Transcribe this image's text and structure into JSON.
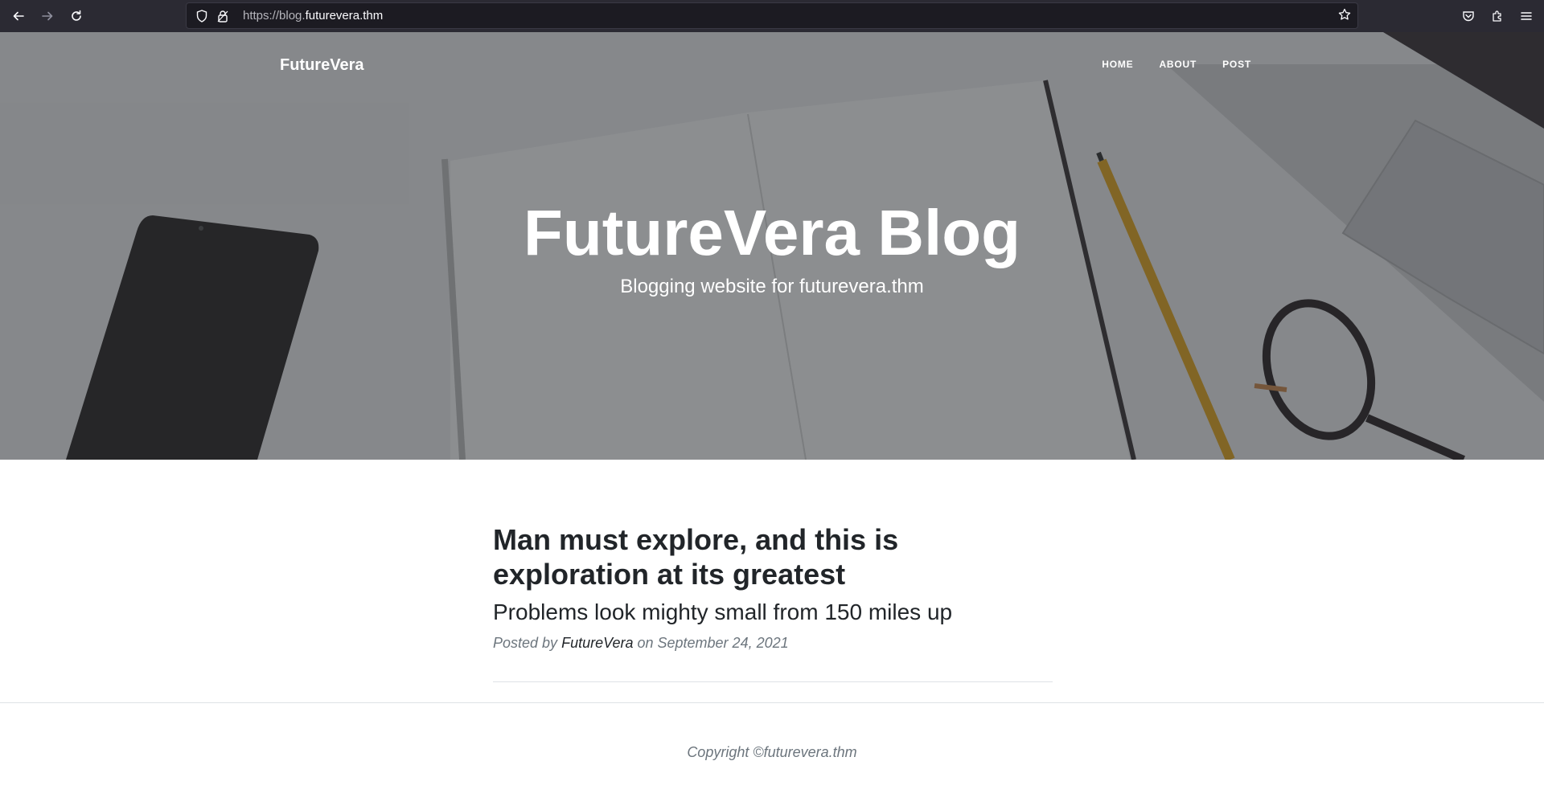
{
  "browser": {
    "url_prefix": "https://blog.",
    "url_host": "futurevera.thm",
    "back_icon": "arrow-left-icon",
    "forward_icon": "arrow-right-icon",
    "reload_icon": "reload-icon"
  },
  "nav": {
    "brand": "FutureVera",
    "links": [
      "HOME",
      "ABOUT",
      "POST"
    ]
  },
  "hero": {
    "heading": "FutureVera Blog",
    "subheading": "Blogging website for futurevera.thm"
  },
  "post": {
    "title": "Man must explore, and this is exploration at its greatest",
    "subtitle": "Problems look mighty small from 150 miles up",
    "meta_prefix": "Posted by",
    "author": "FutureVera",
    "meta_suffix": "on September 24, 2021"
  },
  "footer": {
    "copyright": "Copyright ©futurevera.thm"
  }
}
